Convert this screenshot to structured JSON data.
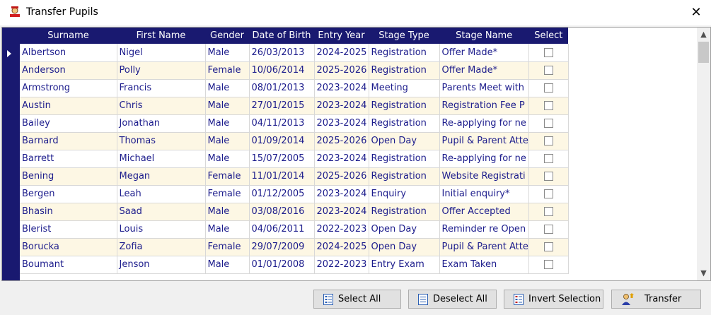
{
  "window": {
    "title": "Transfer Pupils",
    "close_glyph": "✕"
  },
  "colors": {
    "header_bg": "#191970",
    "row_alt_bg": "#fdf7e4",
    "cell_text": "#1c1c8c"
  },
  "grid": {
    "columns": [
      "Surname",
      "First Name",
      "Gender",
      "Date of Birth",
      "Entry Year",
      "Stage Type",
      "Stage Name",
      "Select"
    ],
    "rows": [
      {
        "surname": "Albertson",
        "first_name": "Nigel",
        "gender": "Male",
        "dob": "26/03/2013",
        "entry_year": "2024-2025",
        "stage_type": "Registration",
        "stage_name": "Offer Made*",
        "selected": false
      },
      {
        "surname": "Anderson",
        "first_name": "Polly",
        "gender": "Female",
        "dob": "10/06/2014",
        "entry_year": "2025-2026",
        "stage_type": "Registration",
        "stage_name": "Offer Made*",
        "selected": false
      },
      {
        "surname": "Armstrong",
        "first_name": "Francis",
        "gender": "Male",
        "dob": "08/01/2013",
        "entry_year": "2023-2024",
        "stage_type": "Meeting",
        "stage_name": "Parents Meet with",
        "selected": false
      },
      {
        "surname": "Austin",
        "first_name": "Chris",
        "gender": "Male",
        "dob": "27/01/2015",
        "entry_year": "2023-2024",
        "stage_type": "Registration",
        "stage_name": "Registration Fee P",
        "selected": false
      },
      {
        "surname": "Bailey",
        "first_name": "Jonathan",
        "gender": "Male",
        "dob": "04/11/2013",
        "entry_year": "2023-2024",
        "stage_type": "Registration",
        "stage_name": "Re-applying for ne",
        "selected": false
      },
      {
        "surname": "Barnard",
        "first_name": "Thomas",
        "gender": "Male",
        "dob": "01/09/2014",
        "entry_year": "2025-2026",
        "stage_type": "Open Day",
        "stage_name": "Pupil & Parent Atte",
        "selected": false
      },
      {
        "surname": "Barrett",
        "first_name": "Michael",
        "gender": "Male",
        "dob": "15/07/2005",
        "entry_year": "2023-2024",
        "stage_type": "Registration",
        "stage_name": "Re-applying for ne",
        "selected": false
      },
      {
        "surname": "Bening",
        "first_name": "Megan",
        "gender": "Female",
        "dob": "11/01/2014",
        "entry_year": "2025-2026",
        "stage_type": "Registration",
        "stage_name": "Website Registrati",
        "selected": false
      },
      {
        "surname": "Bergen",
        "first_name": "Leah",
        "gender": "Female",
        "dob": "01/12/2005",
        "entry_year": "2023-2024",
        "stage_type": "Enquiry",
        "stage_name": "Initial enquiry*",
        "selected": false
      },
      {
        "surname": "Bhasin",
        "first_name": "Saad",
        "gender": "Male",
        "dob": "03/08/2016",
        "entry_year": "2023-2024",
        "stage_type": "Registration",
        "stage_name": "Offer Accepted",
        "selected": false
      },
      {
        "surname": "Blerist",
        "first_name": "Louis",
        "gender": "Male",
        "dob": "04/06/2011",
        "entry_year": "2022-2023",
        "stage_type": "Open Day",
        "stage_name": "Reminder re Open",
        "selected": false
      },
      {
        "surname": "Borucka",
        "first_name": "Zofia",
        "gender": "Female",
        "dob": "29/07/2009",
        "entry_year": "2024-2025",
        "stage_type": "Open Day",
        "stage_name": "Pupil & Parent Atte",
        "selected": false
      },
      {
        "surname": "Boumant",
        "first_name": "Jenson",
        "gender": "Male",
        "dob": "01/01/2008",
        "entry_year": "2022-2023",
        "stage_type": "Entry Exam",
        "stage_name": "Exam Taken",
        "selected": false
      }
    ]
  },
  "buttons": {
    "select_all": "Select All",
    "deselect_all": "Deselect All",
    "invert_selection": "Invert Selection",
    "transfer": "Transfer"
  },
  "icons": {
    "app": "transfer-pupils-icon",
    "select_all": "checklist-icon",
    "deselect_all": "list-icon",
    "invert_selection": "invert-list-icon",
    "transfer": "transfer-person-icon"
  }
}
